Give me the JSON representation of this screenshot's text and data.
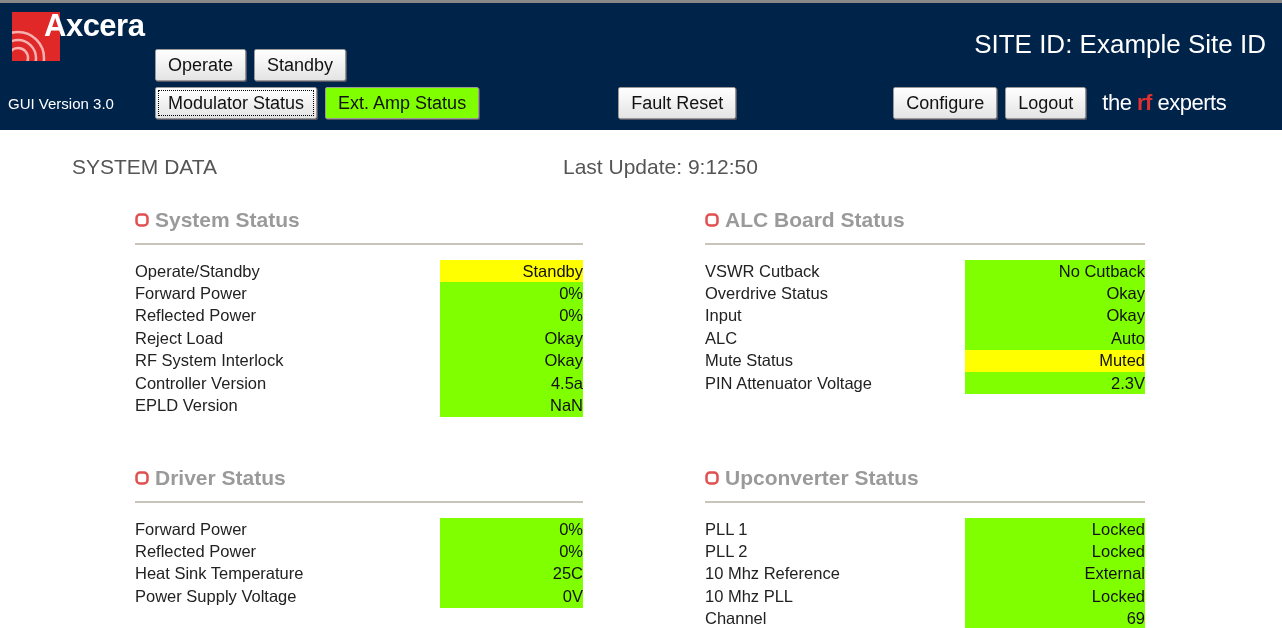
{
  "header": {
    "logo": "Axcera",
    "gui_version": "GUI Version 3.0",
    "site_id": "SITE ID: Example Site ID",
    "tagline": {
      "before": "the",
      "highlight": "rf",
      "after": "experts"
    },
    "mode_buttons": [
      {
        "label": "Operate",
        "selected": false
      },
      {
        "label": "Standby",
        "selected": false
      }
    ],
    "view_buttons": [
      {
        "label": "Modulator Status",
        "selected": false,
        "focused": true
      },
      {
        "label": "Ext. Amp Status",
        "selected": true,
        "focused": false
      }
    ],
    "fault_button": "Fault Reset",
    "right_buttons": [
      "Configure",
      "Logout"
    ]
  },
  "system_data": {
    "title": "SYSTEM DATA",
    "last_update": "Last Update: 9:12:50"
  },
  "sections": [
    {
      "title": "System Status",
      "rows": [
        {
          "label": "Operate/Standby",
          "value": "Standby",
          "color": "#ffff00"
        },
        {
          "label": "Forward Power",
          "value": "0%",
          "color": "#80ff00"
        },
        {
          "label": "Reflected Power",
          "value": "0%",
          "color": "#80ff00"
        },
        {
          "label": "Reject Load",
          "value": "Okay",
          "color": "#80ff00"
        },
        {
          "label": "RF System Interlock",
          "value": "Okay",
          "color": "#80ff00"
        },
        {
          "label": "Controller Version",
          "value": "4.5a",
          "color": "#80ff00"
        },
        {
          "label": "EPLD Version",
          "value": "NaN",
          "color": "#80ff00"
        }
      ]
    },
    {
      "title": "ALC Board Status",
      "rows": [
        {
          "label": "VSWR Cutback",
          "value": "No Cutback",
          "color": "#80ff00"
        },
        {
          "label": "Overdrive Status",
          "value": "Okay",
          "color": "#80ff00"
        },
        {
          "label": "Input",
          "value": "Okay",
          "color": "#80ff00"
        },
        {
          "label": "ALC",
          "value": "Auto",
          "color": "#80ff00"
        },
        {
          "label": "Mute Status",
          "value": "Muted",
          "color": "#ffff00"
        },
        {
          "label": "PIN Attenuator Voltage",
          "value": "2.3V",
          "color": "#80ff00"
        }
      ]
    },
    {
      "title": "Driver Status",
      "rows": [
        {
          "label": "Forward Power",
          "value": "0%",
          "color": "#80ff00"
        },
        {
          "label": "Reflected Power",
          "value": "0%",
          "color": "#80ff00"
        },
        {
          "label": "Heat Sink Temperature",
          "value": "25C",
          "color": "#80ff00"
        },
        {
          "label": "Power Supply Voltage",
          "value": "0V",
          "color": "#80ff00"
        }
      ]
    },
    {
      "title": "Upconverter Status",
      "rows": [
        {
          "label": "PLL 1",
          "value": "Locked",
          "color": "#80ff00"
        },
        {
          "label": "PLL 2",
          "value": "Locked",
          "color": "#80ff00"
        },
        {
          "label": "10 Mhz Reference",
          "value": "External",
          "color": "#80ff00"
        },
        {
          "label": "10 Mhz PLL",
          "value": "Locked",
          "color": "#80ff00"
        },
        {
          "label": "Channel",
          "value": "69",
          "color": "#80ff00"
        }
      ]
    }
  ]
}
